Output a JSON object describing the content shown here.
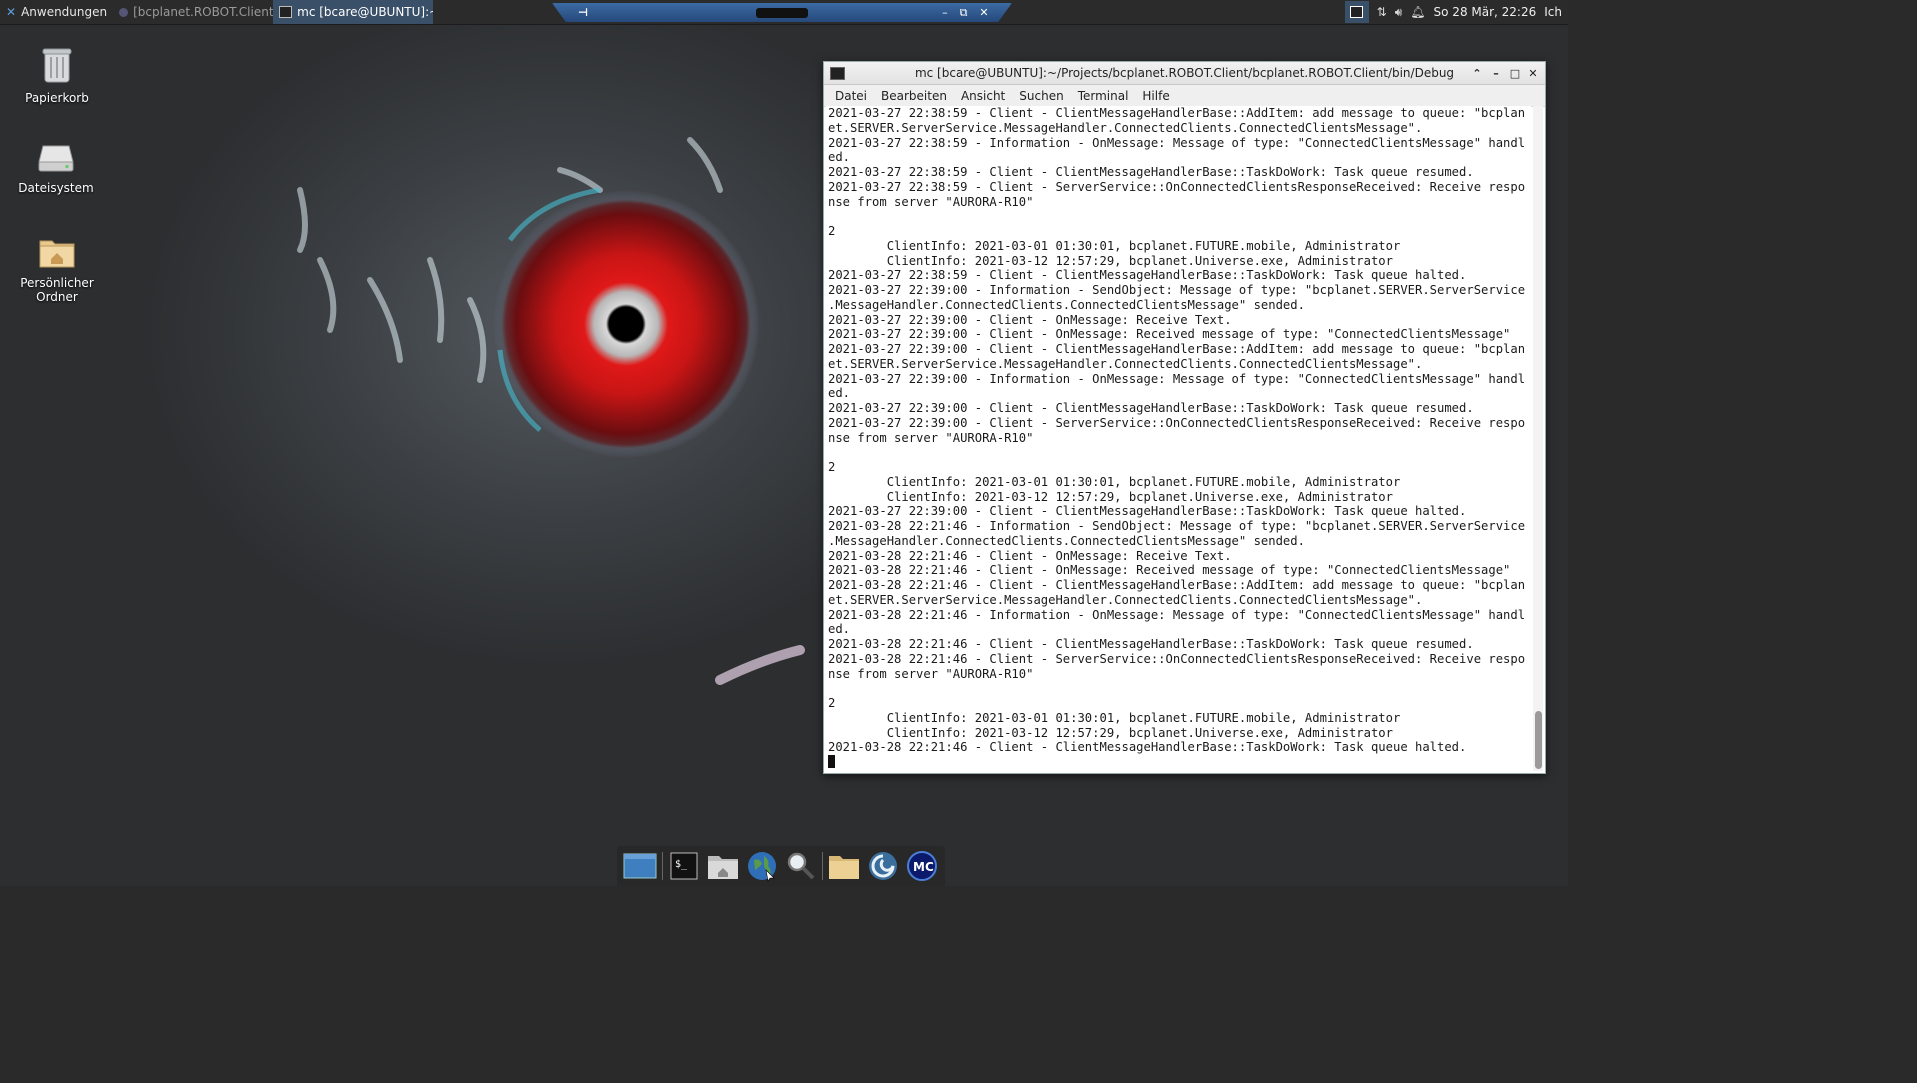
{
  "top_panel": {
    "apps_menu_label": "Anwendungen",
    "tasks": [
      {
        "label": "[bcplanet.ROBOT.Client ...",
        "active": false
      },
      {
        "label": "mc [bcare@UBUNTU]:~...",
        "active": true
      }
    ],
    "clock": "So 28 Mär, 22:26",
    "user": "Ich"
  },
  "desktop_icons": [
    {
      "label": "Papierkorb",
      "icon": "trash-icon"
    },
    {
      "label": "Dateisystem",
      "icon": "drive-icon"
    },
    {
      "label": "Persönlicher Ordner",
      "icon": "home-folder-icon"
    }
  ],
  "terminal": {
    "title": "mc [bcare@UBUNTU]:~/Projects/bcplanet.ROBOT.Client/bcplanet.ROBOT.Client/bin/Debug",
    "menu": [
      "Datei",
      "Bearbeiten",
      "Ansicht",
      "Suchen",
      "Terminal",
      "Hilfe"
    ],
    "lines": [
      "2021-03-27 22:38:59 - Client - ClientMessageHandlerBase::AddItem: add message to queue: \"bcplan",
      "et.SERVER.ServerService.MessageHandler.ConnectedClients.ConnectedClientsMessage\".",
      "2021-03-27 22:38:59 - Information - OnMessage: Message of type: \"ConnectedClientsMessage\" handl",
      "ed.",
      "2021-03-27 22:38:59 - Client - ClientMessageHandlerBase::TaskDoWork: Task queue resumed.",
      "2021-03-27 22:38:59 - Client - ServerService::OnConnectedClientsResponseReceived: Receive respo",
      "nse from server \"AURORA-R10\"",
      "",
      "2",
      "        ClientInfo: 2021-03-01 01:30:01, bcplanet.FUTURE.mobile, Administrator",
      "        ClientInfo: 2021-03-12 12:57:29, bcplanet.Universe.exe, Administrator",
      "2021-03-27 22:38:59 - Client - ClientMessageHandlerBase::TaskDoWork: Task queue halted.",
      "2021-03-27 22:39:00 - Information - SendObject: Message of type: \"bcplanet.SERVER.ServerService",
      ".MessageHandler.ConnectedClients.ConnectedClientsMessage\" sended.",
      "2021-03-27 22:39:00 - Client - OnMessage: Receive Text.",
      "2021-03-27 22:39:00 - Client - OnMessage: Received message of type: \"ConnectedClientsMessage\"",
      "2021-03-27 22:39:00 - Client - ClientMessageHandlerBase::AddItem: add message to queue: \"bcplan",
      "et.SERVER.ServerService.MessageHandler.ConnectedClients.ConnectedClientsMessage\".",
      "2021-03-27 22:39:00 - Information - OnMessage: Message of type: \"ConnectedClientsMessage\" handl",
      "ed.",
      "2021-03-27 22:39:00 - Client - ClientMessageHandlerBase::TaskDoWork: Task queue resumed.",
      "2021-03-27 22:39:00 - Client - ServerService::OnConnectedClientsResponseReceived: Receive respo",
      "nse from server \"AURORA-R10\"",
      "",
      "2",
      "        ClientInfo: 2021-03-01 01:30:01, bcplanet.FUTURE.mobile, Administrator",
      "        ClientInfo: 2021-03-12 12:57:29, bcplanet.Universe.exe, Administrator",
      "2021-03-27 22:39:00 - Client - ClientMessageHandlerBase::TaskDoWork: Task queue halted.",
      "2021-03-28 22:21:46 - Information - SendObject: Message of type: \"bcplanet.SERVER.ServerService",
      ".MessageHandler.ConnectedClients.ConnectedClientsMessage\" sended.",
      "2021-03-28 22:21:46 - Client - OnMessage: Receive Text.",
      "2021-03-28 22:21:46 - Client - OnMessage: Received message of type: \"ConnectedClientsMessage\"",
      "2021-03-28 22:21:46 - Client - ClientMessageHandlerBase::AddItem: add message to queue: \"bcplan",
      "et.SERVER.ServerService.MessageHandler.ConnectedClients.ConnectedClientsMessage\".",
      "2021-03-28 22:21:46 - Information - OnMessage: Message of type: \"ConnectedClientsMessage\" handl",
      "ed.",
      "2021-03-28 22:21:46 - Client - ClientMessageHandlerBase::TaskDoWork: Task queue resumed.",
      "2021-03-28 22:21:46 - Client - ServerService::OnConnectedClientsResponseReceived: Receive respo",
      "nse from server \"AURORA-R10\"",
      "",
      "2",
      "        ClientInfo: 2021-03-01 01:30:01, bcplanet.FUTURE.mobile, Administrator",
      "        ClientInfo: 2021-03-12 12:57:29, bcplanet.Universe.exe, Administrator",
      "2021-03-28 22:21:46 - Client - ClientMessageHandlerBase::TaskDoWork: Task queue halted."
    ]
  },
  "dock": {
    "items": [
      "show-desktop-icon",
      "terminal-icon",
      "home-folder-icon",
      "web-browser-icon",
      "search-icon",
      "folder-icon",
      "debian-swirl-icon",
      "midnight-commander-icon"
    ]
  },
  "colors": {
    "panel_bg": "#2b2b2b",
    "active_task": "#3a4f68",
    "accent_blue": "#3c6aa3",
    "eye_red": "#e01818"
  }
}
